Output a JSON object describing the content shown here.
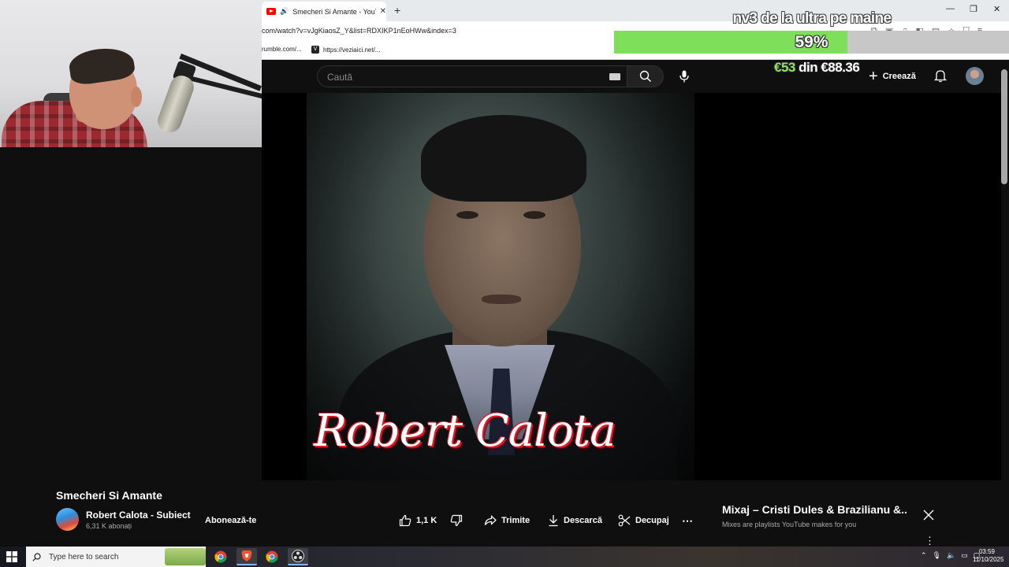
{
  "browser": {
    "tab_title": "Smecheri Si Amante - YouTube",
    "url": "com/watch?v=vJgKiaosZ_Y&list=RDXIKP1nEoHWw&index=3",
    "bookmarks": [
      {
        "label": "rumble.com/..."
      },
      {
        "label": "https://veziaici.net/..."
      }
    ]
  },
  "stream_overlay": {
    "goal_title": "nv3 de la ultra pe maine",
    "goal_percent_text": "59%",
    "goal_progress": 0.59,
    "current_amount": "€53",
    "amount_joiner": "din",
    "target_amount": "€88.36"
  },
  "youtube": {
    "search_placeholder": "Caută",
    "create_label": "Creează",
    "video_caption": "Robert Calota",
    "video_title": "Smecheri Si Amante",
    "channel_name": "Robert Calota - Subiect",
    "subscribers": "6,31 K abonați",
    "subscribe_label": "Abonează-te",
    "likes": "1,1 K",
    "share_label": "Trimite",
    "download_label": "Descarcă",
    "clip_label": "Decupaj",
    "mix_title": "Mixaj – Cristi Dules & Brazilianu &...",
    "mix_subtitle": "Mixes are playlists YouTube makes for you"
  },
  "taskbar": {
    "search_placeholder": "Type here to search",
    "time": "03:59",
    "date": "11/10/2025"
  },
  "colors": {
    "youtube_bg": "#0f0f0f",
    "progress_fill": "#7ee05a",
    "brand_red": "#ff0000"
  }
}
